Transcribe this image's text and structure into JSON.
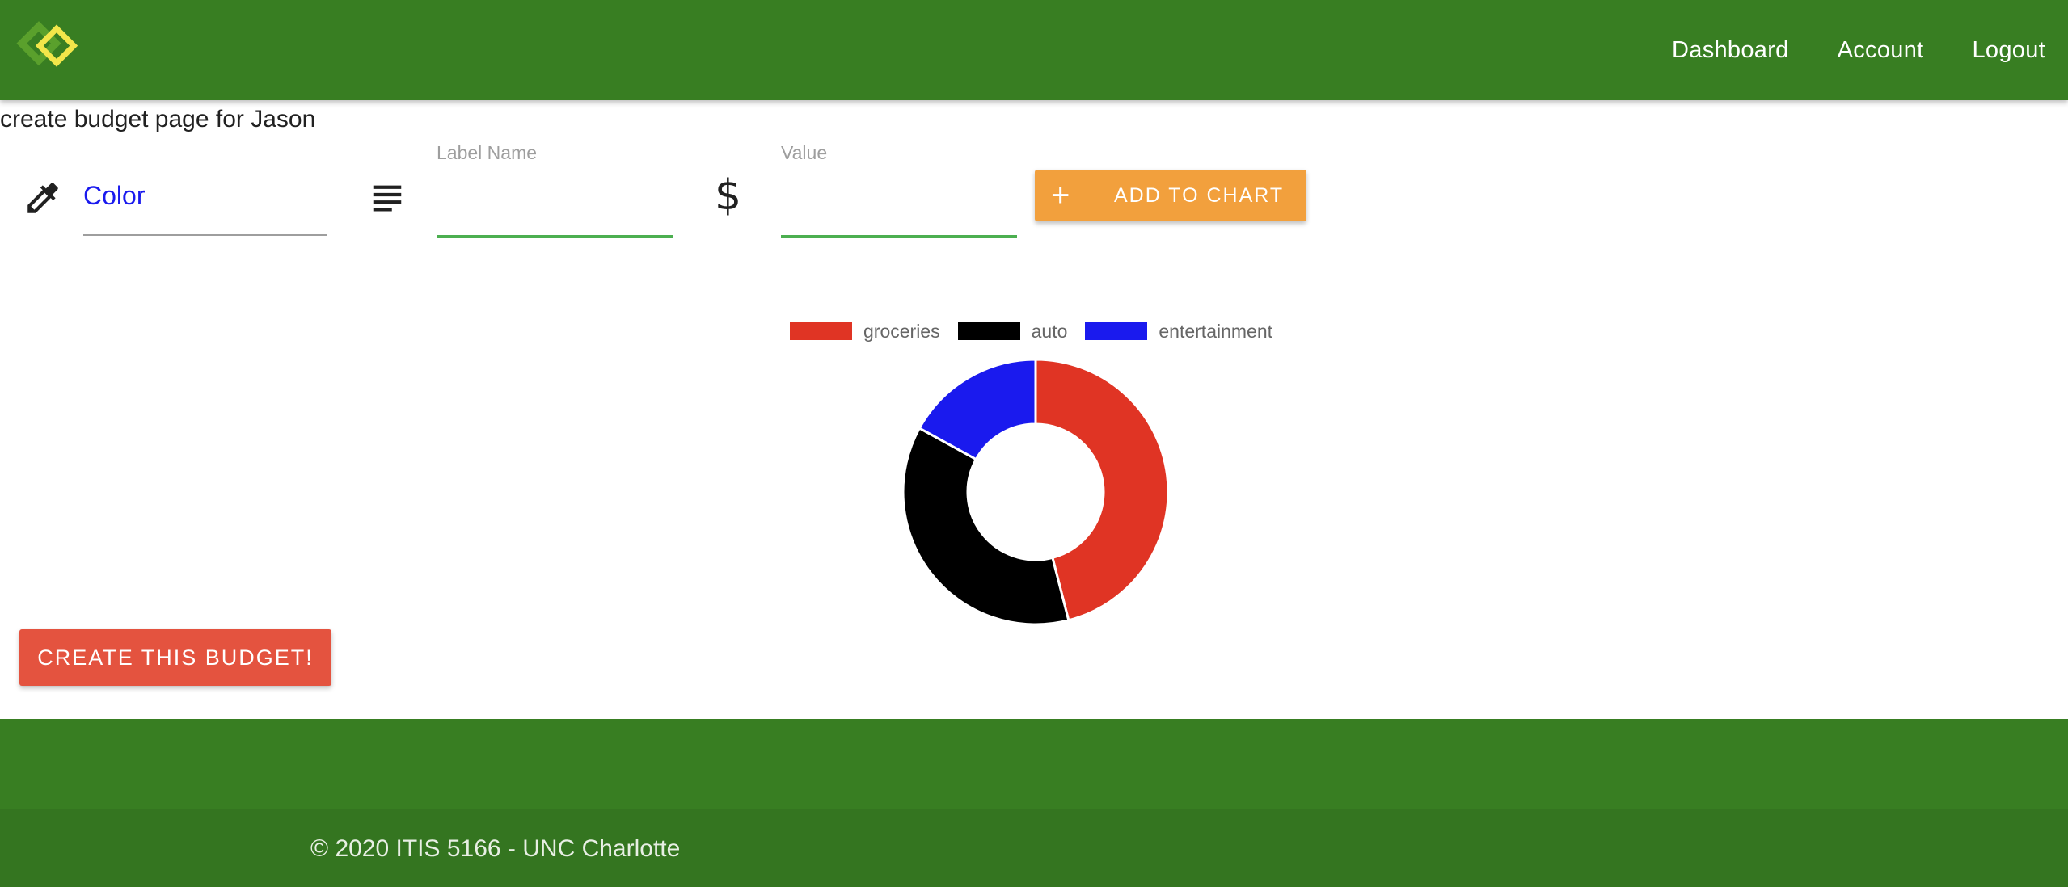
{
  "header": {
    "nav": [
      "Dashboard",
      "Account",
      "Logout"
    ],
    "brand_colors": {
      "primary": "#387e22",
      "logo_yellow": "#f2e64a",
      "logo_green": "#5aa02c"
    }
  },
  "page": {
    "heading": "create budget page for Jason"
  },
  "form": {
    "color_icon": "eyedropper-icon",
    "color_value": "Color",
    "color_value_color": "#1a1aee",
    "label_icon": "text-lines-icon",
    "label_field_label": "Label Name",
    "label_field_value": "",
    "value_icon": "dollar-icon",
    "value_field_label": "Value",
    "value_field_value": "",
    "add_button": {
      "icon": "plus-icon",
      "label": "ADD TO CHART",
      "color": "#f2a03d"
    }
  },
  "chart_data": {
    "type": "pie",
    "donut": true,
    "legend_position": "top",
    "labels": [
      "groceries",
      "auto",
      "entertainment"
    ],
    "values": [
      46,
      37,
      17
    ],
    "colors": [
      "#e03424",
      "#000000",
      "#1a1aee"
    ]
  },
  "actions": {
    "create_button": {
      "label": "CREATE THIS BUDGET!",
      "color": "#e4533f"
    }
  },
  "footer": {
    "text": "© 2020 ITIS 5166 - UNC Charlotte"
  }
}
